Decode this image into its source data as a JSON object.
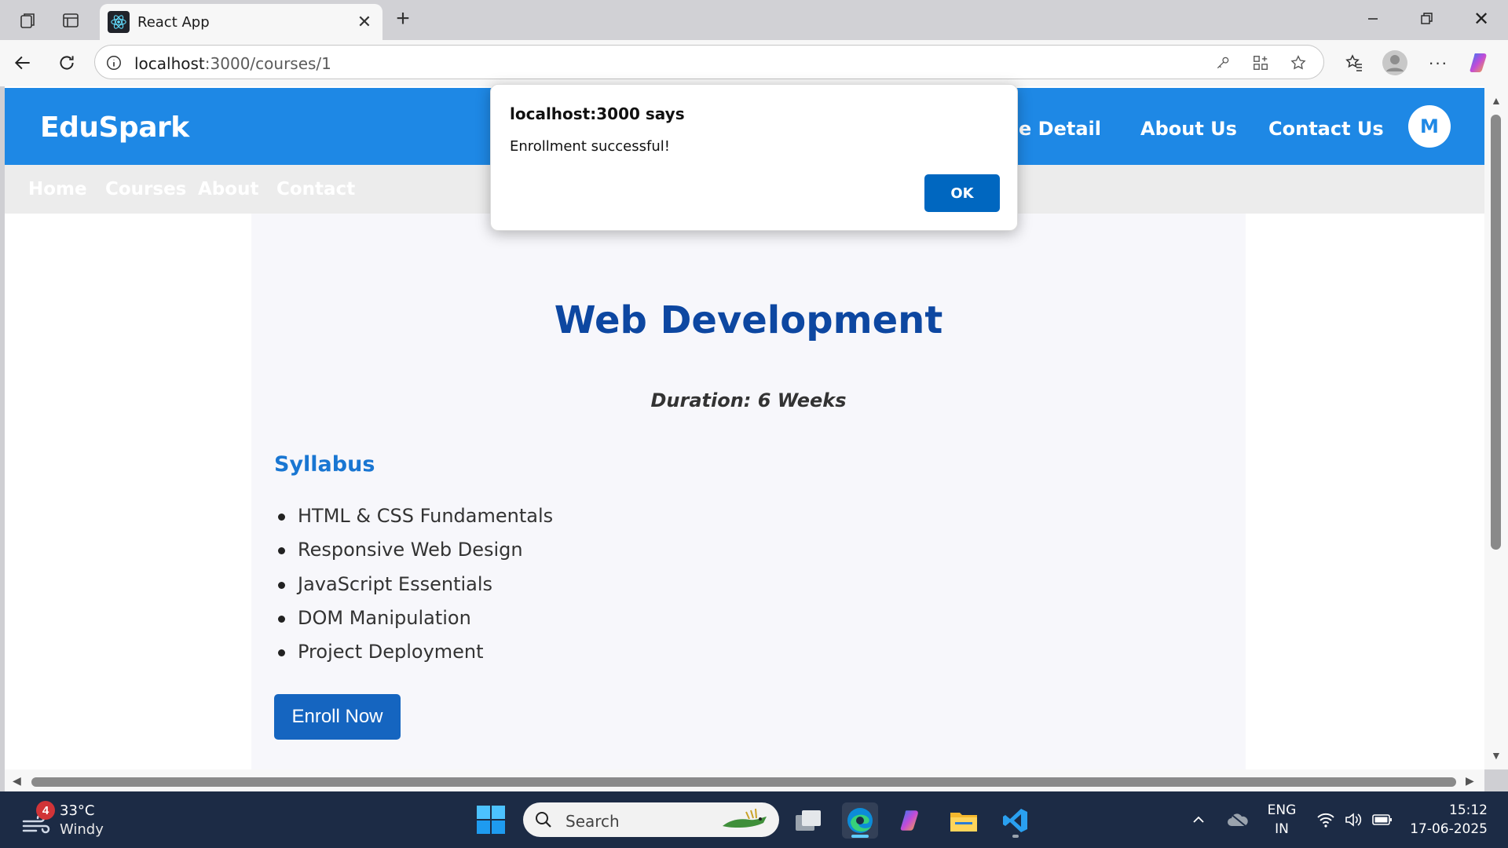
{
  "browser": {
    "tab_title": "React App",
    "url_host": "localhost",
    "url_path": ":3000/courses/1"
  },
  "header": {
    "brand": "EduSpark",
    "nav": [
      "rse Detail",
      "About Us",
      "Contact Us"
    ],
    "avatar_initial": "M"
  },
  "subnav": [
    "Home",
    "Courses",
    "About",
    "Contact"
  ],
  "course": {
    "title": "Web Development",
    "duration": "Duration: 6 Weeks",
    "syllabus_heading": "Syllabus",
    "syllabus": [
      "HTML & CSS Fundamentals",
      "Responsive Web Design",
      "JavaScript Essentials",
      "DOM Manipulation",
      "Project Deployment"
    ],
    "enroll_label": "Enroll Now"
  },
  "dialog": {
    "title": "localhost:3000 says",
    "message": "Enrollment successful!",
    "ok_label": "OK"
  },
  "taskbar": {
    "weather_badge": "4",
    "temperature": "33°C",
    "condition": "Windy",
    "search_placeholder": "Search",
    "language": "ENG",
    "region": "IN",
    "time": "15:12",
    "date": "17-06-2025"
  },
  "colors": {
    "header_blue": "#1e88e5",
    "title_blue": "#0d47a1",
    "button_blue": "#1565c0",
    "dialog_ok": "#0067c0",
    "taskbar": "#1c2b45"
  }
}
